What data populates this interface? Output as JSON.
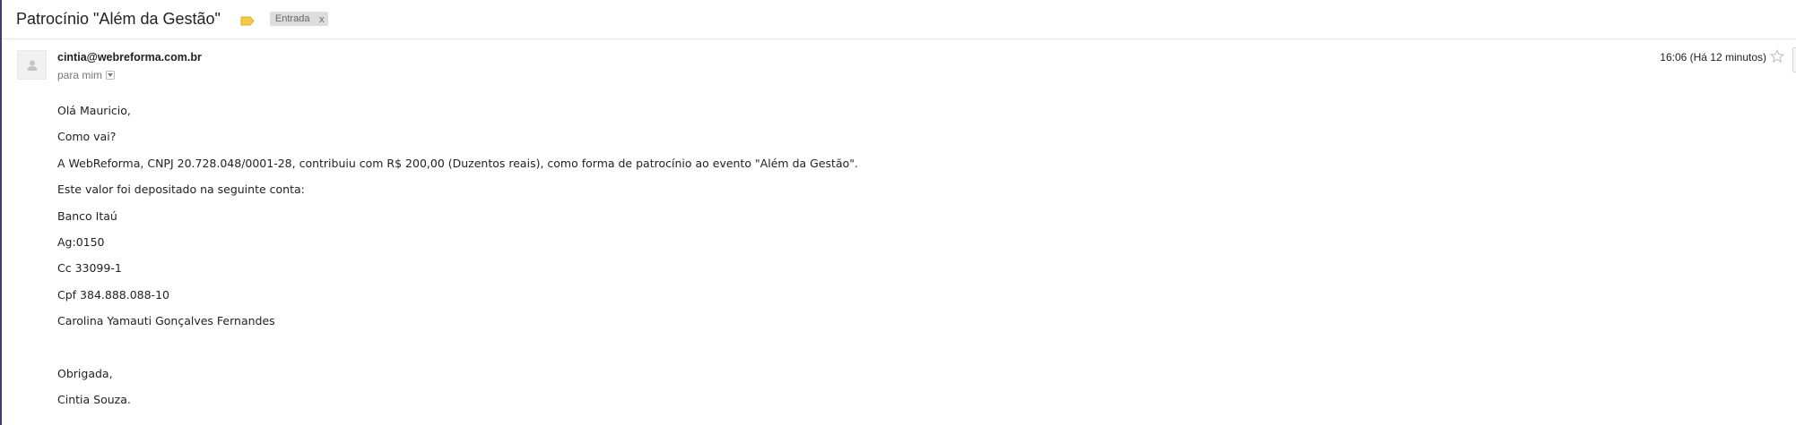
{
  "header": {
    "subject": "Patrocínio \"Além da Gestão\"",
    "importance_icon": "importance-marker-icon",
    "label": {
      "text": "Entrada",
      "remove": "x"
    }
  },
  "sender": {
    "email": "cintia@webreforma.com.br",
    "recipient_text": "para mim",
    "timestamp": "16:06 (Há 12 minutos)",
    "avatar_icon": "avatar-icon",
    "star_icon": "star-icon"
  },
  "body": {
    "lines": [
      "Olá Mauricio,",
      "Como vai?",
      "A WebReforma, CNPJ 20.728.048/0001-28, contribuiu com R$ 200,00 (Duzentos reais), como forma de patrocínio ao evento \"Além da Gestão\".",
      "Este valor foi depositado na seguinte conta:",
      "Banco Itaú",
      "Ag:0150",
      "Cc 33099-1",
      "Cpf 384.888.088-10",
      "Carolina Yamauti Gonçalves Fernandes",
      "",
      "Obrigada,",
      "Cintia Souza."
    ]
  },
  "colors": {
    "importance": "#f7c948",
    "label_bg": "#dddddd",
    "divider": "#e5e5e5"
  }
}
